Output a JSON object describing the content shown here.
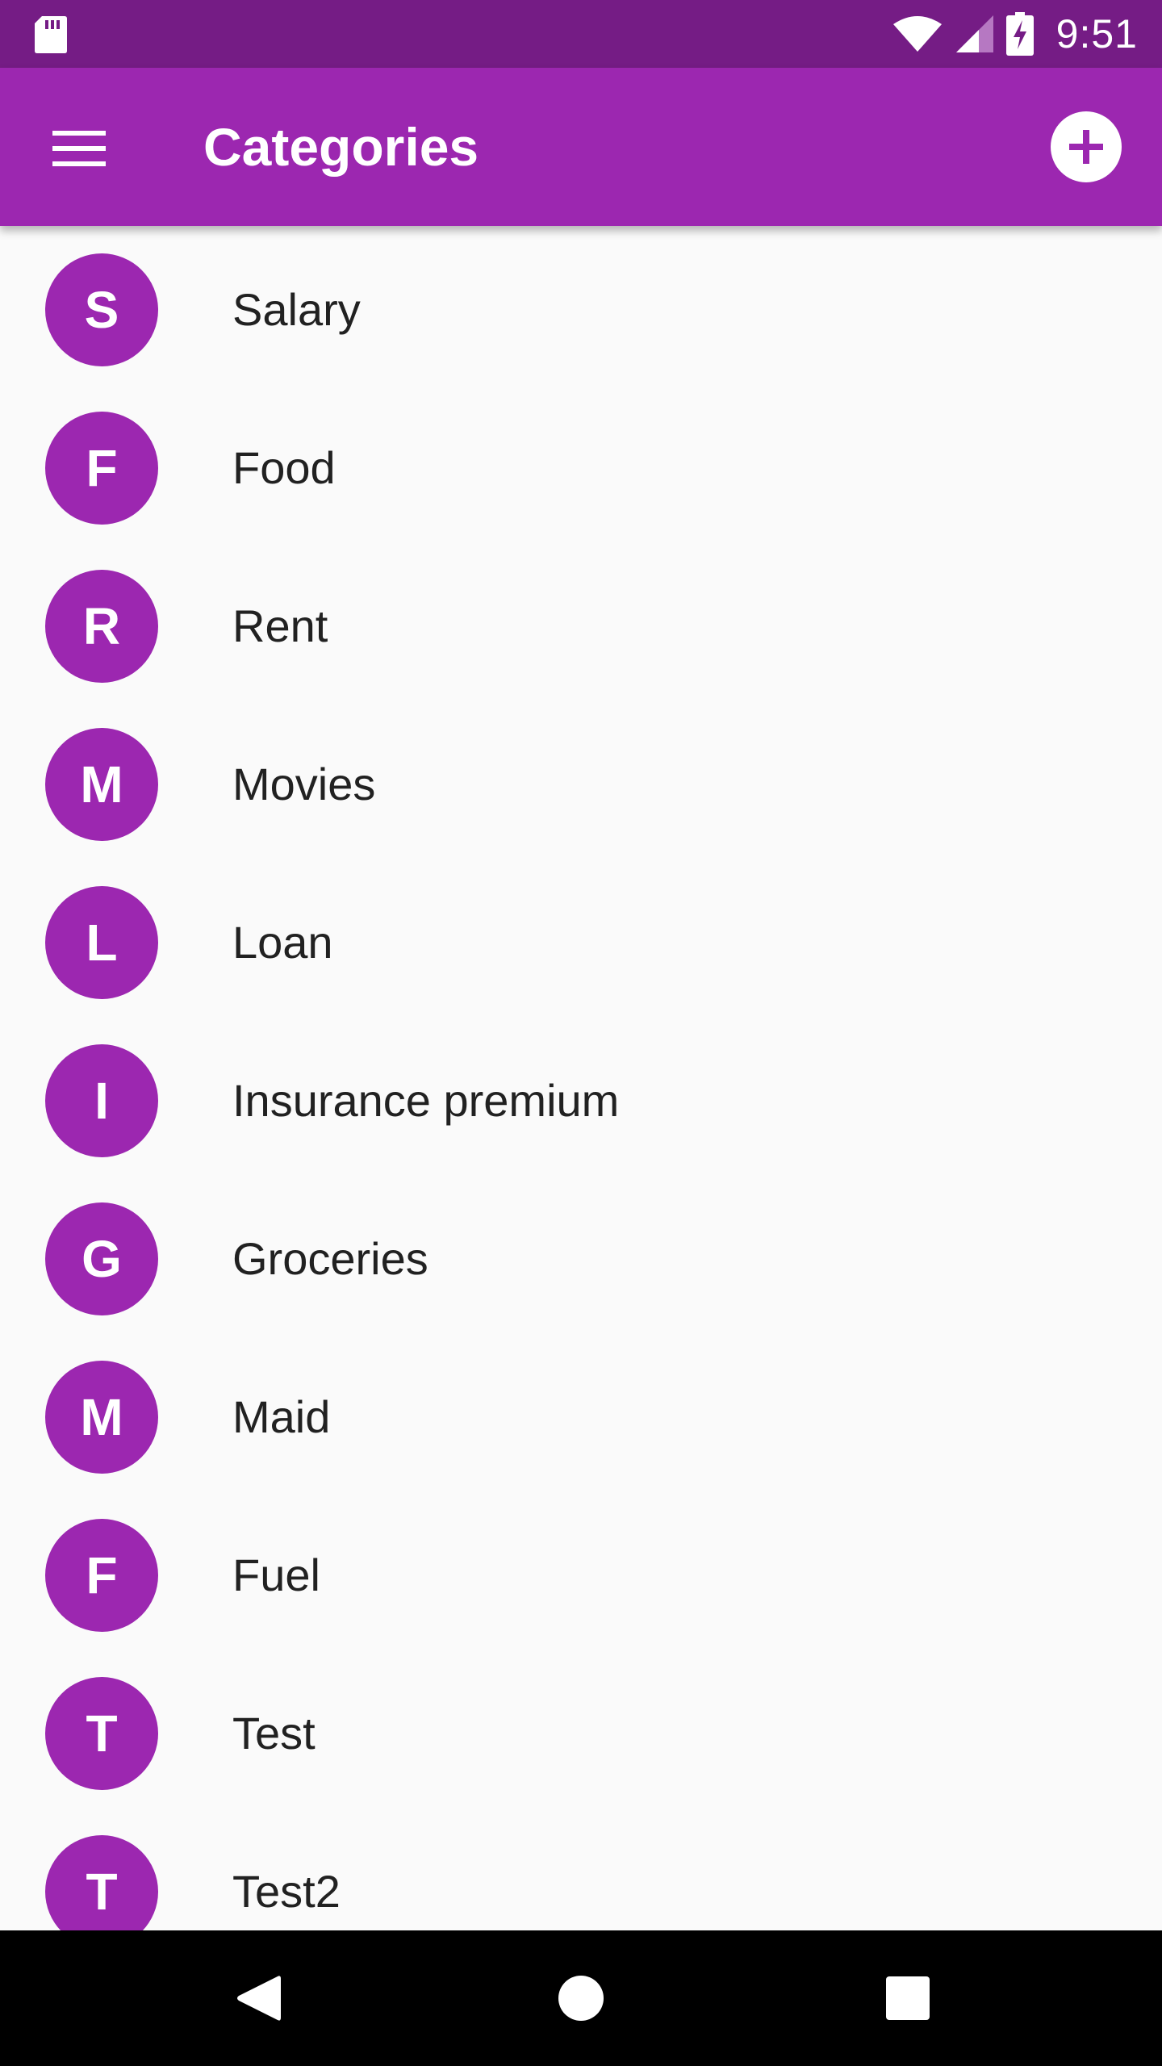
{
  "status_bar": {
    "time": "9:51",
    "icons": [
      "sd-card-icon",
      "wifi-icon",
      "cell-signal-icon",
      "battery-charging-icon"
    ]
  },
  "app_bar": {
    "title": "Categories",
    "menu_icon": "hamburger-menu-icon",
    "add_icon": "add-circle-icon"
  },
  "categories": [
    {
      "initial": "S",
      "label": "Salary"
    },
    {
      "initial": "F",
      "label": "Food"
    },
    {
      "initial": "R",
      "label": "Rent"
    },
    {
      "initial": "M",
      "label": "Movies"
    },
    {
      "initial": "L",
      "label": "Loan"
    },
    {
      "initial": "I",
      "label": "Insurance premium"
    },
    {
      "initial": "G",
      "label": "Groceries"
    },
    {
      "initial": "M",
      "label": "Maid"
    },
    {
      "initial": "F",
      "label": "Fuel"
    },
    {
      "initial": "T",
      "label": "Test"
    },
    {
      "initial": "T",
      "label": "Test2"
    }
  ],
  "nav_bar": {
    "icons": [
      "back-icon",
      "home-icon",
      "recents-icon"
    ]
  },
  "colors": {
    "primary": "#9c27b0",
    "primary_dark": "#751c85",
    "background": "#fafafa",
    "text": "#212121"
  }
}
